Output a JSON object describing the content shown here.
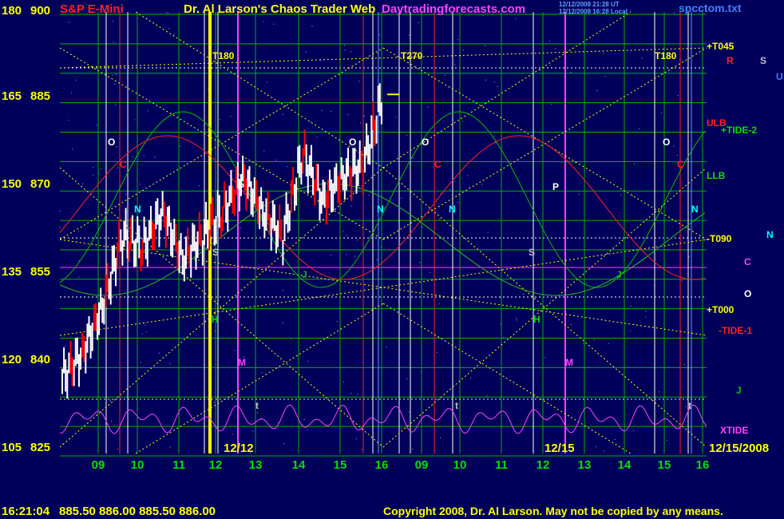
{
  "header": {
    "price_top_left": "180",
    "price_top_right": "900",
    "symbol": "S&P E-Mini",
    "title": "Dr. Al Larson's Chaos Trader Web",
    "site": "Daytradingforecasts.com",
    "stamp1": "12/12/2008 21:28 UT",
    "stamp2": "12/12/2008 16:28 Local",
    "file": "spcctom.txt"
  },
  "footer": {
    "time": "16:21:04",
    "quotes": "885.50  886.00  885.50  886.00",
    "copyright": "Copyright 2008, Dr. Al Larson. May not be copied by any means."
  },
  "colors": {
    "background": "#00005a",
    "price_bars": "#ffffff",
    "down_bars": "#ff0000",
    "grid_green": "#00b000",
    "time_lines_white": "#ffffff",
    "time_lines_red": "#ff0000",
    "yellow": "#ffff00",
    "magenta": "#ff40ff",
    "cyan": "#00ffff"
  },
  "chart_data": {
    "type": "line",
    "title": "S&P E-Mini",
    "y_left_ticks": [
      "180",
      "165",
      "150",
      "135",
      "120",
      "105"
    ],
    "y_right_ticks": [
      "900",
      "885",
      "870",
      "855",
      "840",
      "825"
    ],
    "ylim": [
      825,
      900
    ],
    "x_ticks": [
      "09",
      "10",
      "11",
      "12",
      "13",
      "14",
      "15",
      "16",
      "09",
      "10",
      "11",
      "12",
      "13",
      "14",
      "15",
      "16"
    ],
    "date_labels": [
      "12/12",
      "12/15",
      "12/15/2008"
    ],
    "series": [
      {
        "name": "price",
        "x": [
          0,
          0.5,
          1,
          1.5,
          2,
          2.5,
          3,
          3.5,
          4,
          4.5,
          5,
          5.5,
          6,
          6.5,
          7,
          7.5,
          8
        ],
        "values": [
          838,
          842,
          850,
          862,
          860,
          866,
          858,
          862,
          866,
          872,
          866,
          862,
          876,
          868,
          872,
          874,
          886
        ]
      }
    ],
    "right_labels": [
      "+T045",
      "R",
      "S",
      "U",
      "ULB",
      "+TIDE-2",
      "LLB",
      "N",
      "-T090",
      "C",
      "O",
      "+T000",
      "-TIDE-1",
      "J",
      "XTIDE"
    ],
    "time_markers": [
      "T180",
      "T270",
      "T180"
    ],
    "letter_markers": [
      "O",
      "C",
      "N",
      "S",
      "P",
      "H",
      "M",
      "J",
      "t"
    ]
  }
}
